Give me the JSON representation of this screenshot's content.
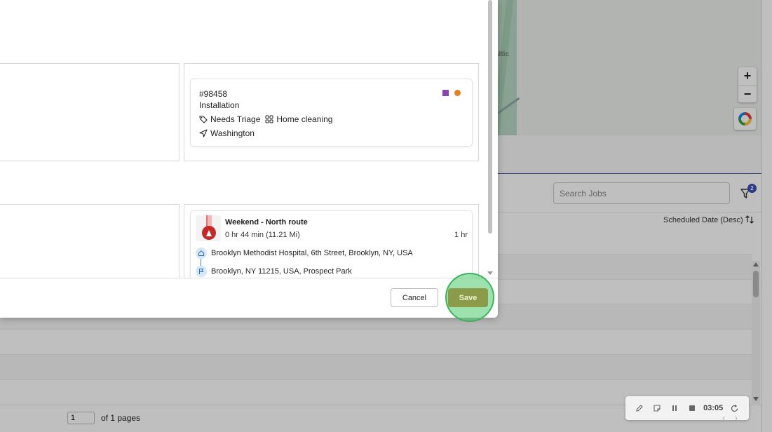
{
  "map": {
    "place_label": "altic",
    "zoom_in": "+",
    "zoom_out": "−"
  },
  "jobs_list": {
    "search_placeholder": "Search Jobs",
    "filter_count": "2",
    "sort_label": "Scheduled Date (Desc)"
  },
  "pagination": {
    "current_page": "1",
    "of_pages": "of 1 pages"
  },
  "recorder": {
    "time": "03:05"
  },
  "modal": {
    "job_card": {
      "id": "#98458",
      "type": "Installation",
      "tag": "Needs Triage",
      "category": "Home cleaning",
      "location": "Washington",
      "color_square": "#8e44ad",
      "color_dot": "#e67e22"
    },
    "route_card": {
      "name": "Weekend - North route",
      "duration": "0 hr 44 min (11.21 Mi)",
      "length": "1 hr",
      "start": "Brooklyn Methodist Hospital, 6th Street, Brooklyn, NY, USA",
      "end": "Brooklyn, NY 11215, USA, Prospect Park"
    },
    "cancel_label": "Cancel",
    "save_label": "Save"
  },
  "colors": {
    "accent": "#3d4db7",
    "save_button": "#8a9c4a",
    "highlight_ring": "#3cb35c"
  }
}
